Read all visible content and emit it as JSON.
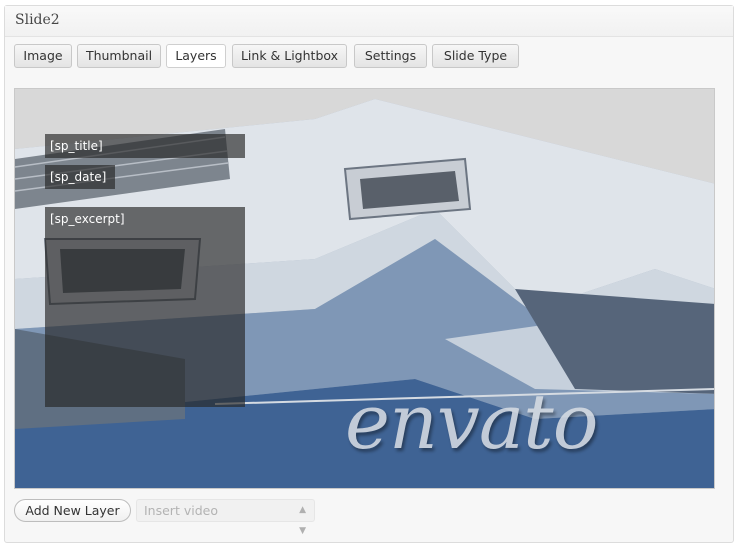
{
  "panel": {
    "title": "Slide2"
  },
  "tabs": [
    {
      "label": "Image"
    },
    {
      "label": "Thumbnail"
    },
    {
      "label": "Layers",
      "active": true
    },
    {
      "label": "Link & Lightbox"
    },
    {
      "label": "Settings"
    },
    {
      "label": "Slide Type"
    }
  ],
  "layers": [
    {
      "label": "[sp_title]"
    },
    {
      "label": "[sp_date]"
    },
    {
      "label": "[sp_excerpt]"
    }
  ],
  "watermark": {
    "text": "envato"
  },
  "footer": {
    "add_layer_label": "Add New Layer",
    "insert_video_placeholder": "Insert video",
    "insert_video_icon": "updown-chevron-icon"
  },
  "colors": {
    "layer_bg": "#262626",
    "panel_bg": "#f7f7f7",
    "tab_border": "#c8c8c8",
    "sky": "#d6d6d6",
    "roof": "#dfe4ea",
    "shadow": "#3c5f8f"
  }
}
